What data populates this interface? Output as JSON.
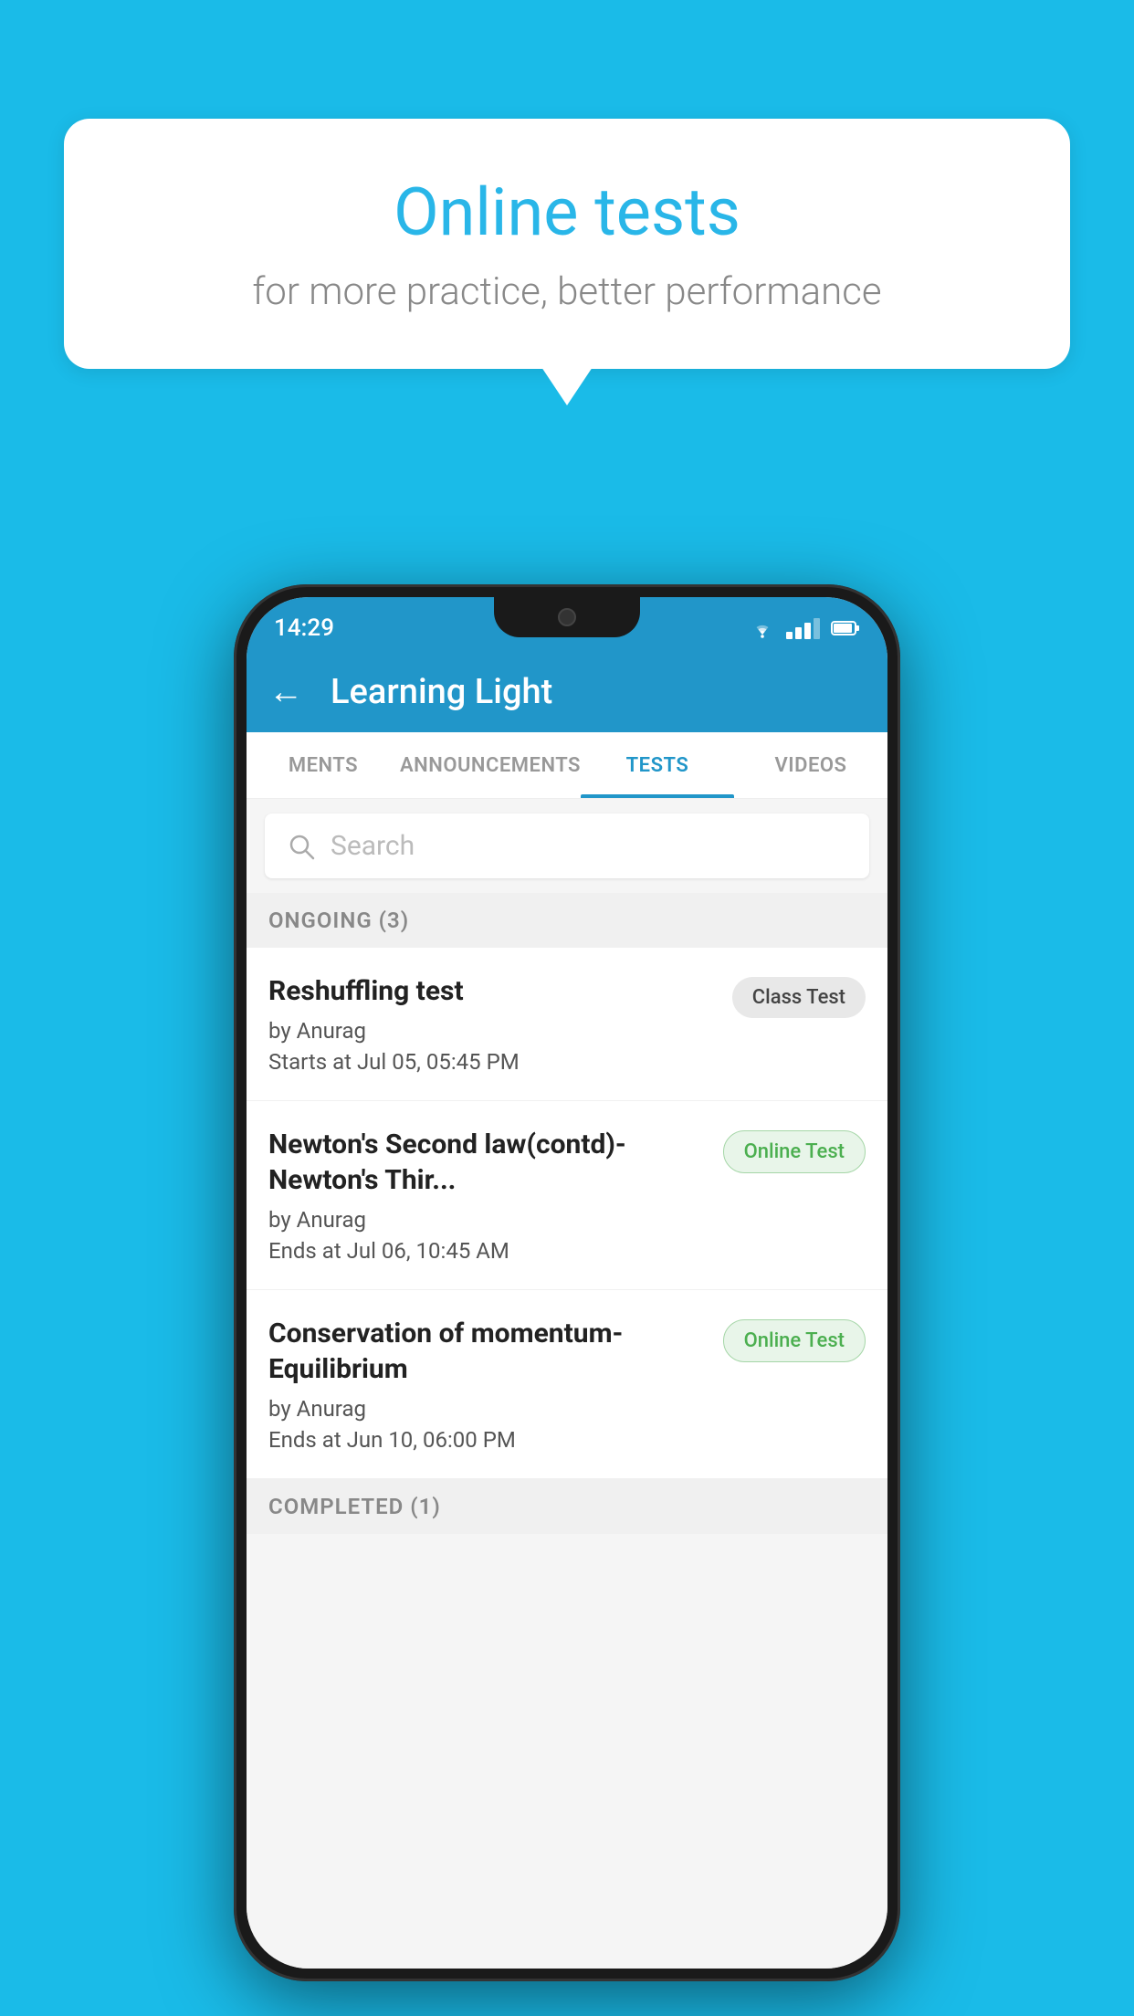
{
  "background": {
    "color": "#1ABBE8"
  },
  "speech_bubble": {
    "title": "Online tests",
    "subtitle": "for more practice, better performance"
  },
  "phone": {
    "status_bar": {
      "time": "14:29",
      "icons": [
        "wifi",
        "signal",
        "battery"
      ]
    },
    "app_bar": {
      "title": "Learning Light",
      "back_label": "←"
    },
    "tabs": [
      {
        "label": "MENTS",
        "active": false
      },
      {
        "label": "ANNOUNCEMENTS",
        "active": false
      },
      {
        "label": "TESTS",
        "active": true
      },
      {
        "label": "VIDEOS",
        "active": false
      }
    ],
    "search": {
      "placeholder": "Search"
    },
    "ongoing_section": {
      "label": "ONGOING (3)"
    },
    "test_items": [
      {
        "name": "Reshuffling test",
        "author": "by Anurag",
        "time_label": "Starts at",
        "time": "Jul 05, 05:45 PM",
        "badge": "Class Test",
        "badge_type": "class"
      },
      {
        "name": "Newton's Second law(contd)-Newton's Thir...",
        "author": "by Anurag",
        "time_label": "Ends at",
        "time": "Jul 06, 10:45 AM",
        "badge": "Online Test",
        "badge_type": "online"
      },
      {
        "name": "Conservation of momentum-Equilibrium",
        "author": "by Anurag",
        "time_label": "Ends at",
        "time": "Jun 10, 06:00 PM",
        "badge": "Online Test",
        "badge_type": "online"
      }
    ],
    "completed_section": {
      "label": "COMPLETED (1)"
    }
  }
}
